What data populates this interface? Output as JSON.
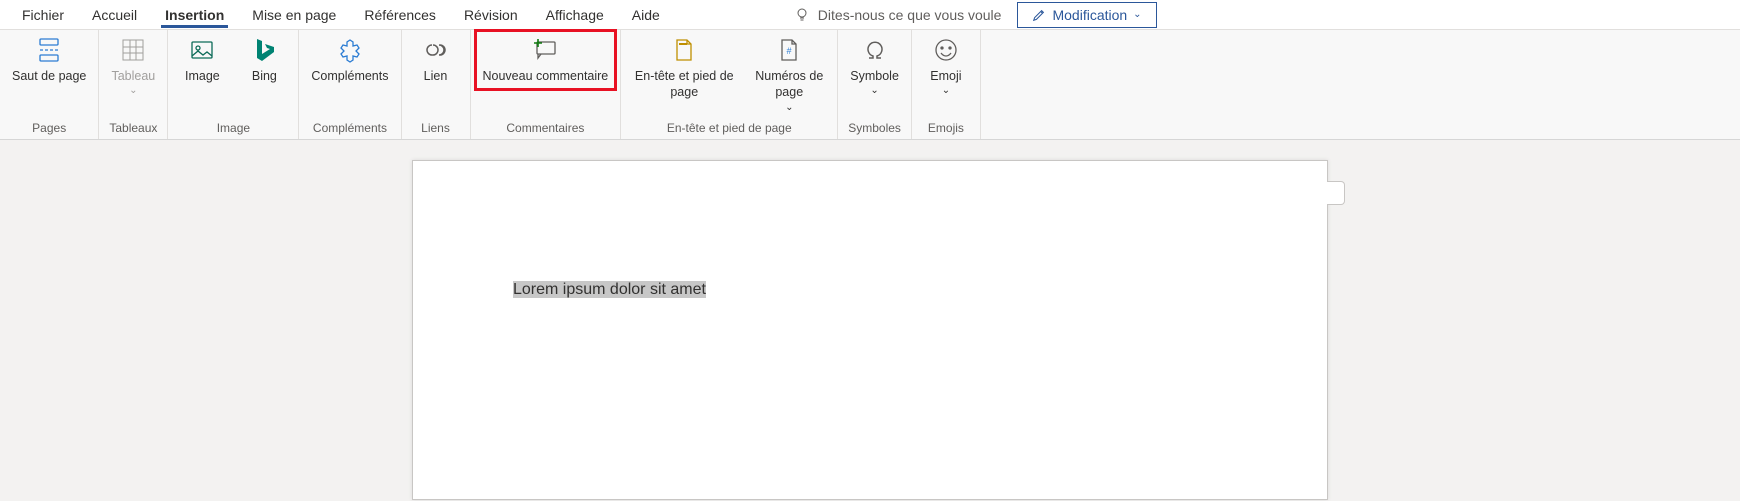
{
  "tabs": {
    "fichier": "Fichier",
    "accueil": "Accueil",
    "insertion": "Insertion",
    "mise_en_page": "Mise en page",
    "references": "Références",
    "revision": "Révision",
    "affichage": "Affichage",
    "aide": "Aide"
  },
  "tellme": "Dites-nous ce que vous voule",
  "modification": "Modification",
  "ribbon": {
    "pages": {
      "label": "Pages",
      "saut": "Saut de page"
    },
    "tableaux": {
      "label": "Tableaux",
      "tableau": "Tableau"
    },
    "image_group": {
      "label": "Image",
      "image": "Image",
      "bing": "Bing"
    },
    "complements": {
      "label": "Compléments",
      "btn": "Compléments"
    },
    "liens": {
      "label": "Liens",
      "lien": "Lien"
    },
    "commentaires": {
      "label": "Commentaires",
      "nouveau": "Nouveau commentaire"
    },
    "entete": {
      "label": "En-tête et pied de page",
      "entete_btn": "En-tête et pied de page",
      "numeros": "Numéros de page"
    },
    "symboles": {
      "label": "Symboles",
      "symbole": "Symbole"
    },
    "emojis": {
      "label": "Emojis",
      "emoji": "Emoji"
    }
  },
  "document": {
    "text": "Lorem ipsum dolor sit amet"
  }
}
